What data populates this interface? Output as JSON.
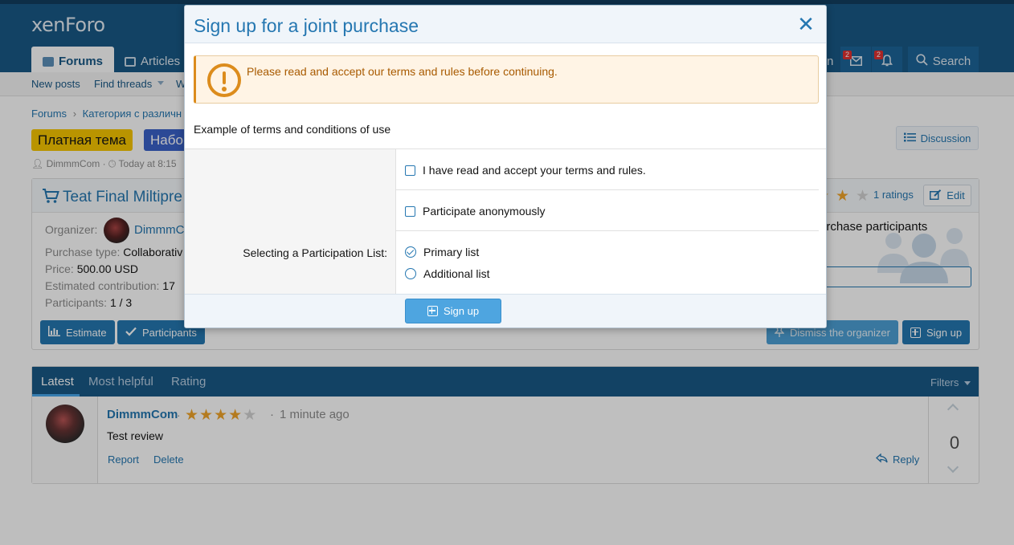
{
  "header": {
    "logo": "xenForo",
    "nav_tabs": [
      {
        "label": "Forums",
        "active": true
      },
      {
        "label": "Articles",
        "active": false
      }
    ],
    "user_partial": "n",
    "inbox_badge": "2",
    "alerts_badge": "2",
    "search_label": "Search"
  },
  "subnav": {
    "new_posts": "New posts",
    "find_threads": "Find threads",
    "partial": "W"
  },
  "breadcrumb": {
    "root": "Forums",
    "category": "Категория с различн"
  },
  "thread": {
    "prefix_paid": "Платная тема",
    "prefix_second": "Набо",
    "author": "DimmmCom",
    "time": "Today at 8:15",
    "discussion_label": "Discussion"
  },
  "product": {
    "title": "Teat Final Miltipre",
    "ratings": "1 ratings",
    "edit_label": "Edit",
    "organizer_label": "Organizer:",
    "organizer_name": "DimmmC",
    "purchase_type_label": "Purchase type:",
    "purchase_type_value": "Collaborativ",
    "price_label": "Price:",
    "price_value": "500.00 USD",
    "contribution_label": "Estimated contribution:",
    "contribution_value": "17",
    "participants_label": "Participants:",
    "participants_value": "1 / 3",
    "participants_panel_text": "urchase participants",
    "estimate_button": "Estimate",
    "participants_button": "Participants",
    "dismiss_button": "Dismiss the organizer",
    "signup_button": "Sign up"
  },
  "reviews": {
    "tabs": [
      "Latest",
      "Most helpful",
      "Rating"
    ],
    "filters": "Filters",
    "items": [
      {
        "author": "DimmmCom",
        "rating": 4,
        "time": "1 minute ago",
        "text": "Test review",
        "report": "Report",
        "delete": "Delete",
        "reply": "Reply",
        "votes": "0"
      }
    ]
  },
  "modal": {
    "title": "Sign up for a joint purchase",
    "notice": "Please read and accept our terms and rules before continuing.",
    "terms_text": "Example of terms and conditions of use",
    "accept_terms_label": "I have read and accept your terms and rules.",
    "anonymous_label": "Participate anonymously",
    "list_label": "Selecting a Participation List:",
    "list_options": [
      {
        "label": "Primary list",
        "selected": true
      },
      {
        "label": "Additional list",
        "selected": false
      }
    ],
    "submit_label": "Sign up"
  },
  "colors": {
    "header": "#185886",
    "accent": "#2577b1",
    "warning": "#dc8c1c",
    "star": "#f0a52a"
  }
}
